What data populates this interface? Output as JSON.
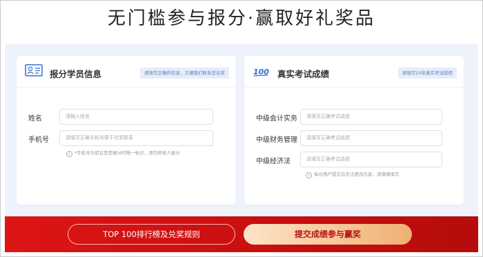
{
  "page": {
    "title": "无门槛参与报分·赢取好礼奖品"
  },
  "student_card": {
    "title": "报分学员信息",
    "hint": "请填写正确的信息，方便我们联系您兑奖",
    "icon": "id-card-icon",
    "fields": [
      {
        "label": "姓名",
        "placeholder": "请输入姓名"
      },
      {
        "label": "手机号",
        "placeholder": "请填写正确手机号便于兑奖联系"
      }
    ],
    "note": "*手机号为验证是否报分的唯一标识，请勿帮他人报分"
  },
  "score_card": {
    "title": "真实考试成绩",
    "hint": "请填写23年真实考试成绩",
    "icon": "100-score-icon",
    "icon_text": "100",
    "fields": [
      {
        "label": "中级会计实务",
        "placeholder": "请填写正确考试成绩"
      },
      {
        "label": "中级财务管理",
        "placeholder": "请填写正确考试成绩"
      },
      {
        "label": "中级经济法",
        "placeholder": "请填写正确考试成绩"
      }
    ],
    "note": "每位用户提交后无法更改信息，请谨慎填写"
  },
  "actions": {
    "rank_label": "TOP 100排行榜及兑奖规则",
    "submit_label": "提交成绩参与赢奖"
  },
  "colors": {
    "accent_red": "#d41414",
    "submit_text": "#b5161b",
    "hint_bg": "#e6eefa",
    "panel_bg": "#eef3fb"
  }
}
